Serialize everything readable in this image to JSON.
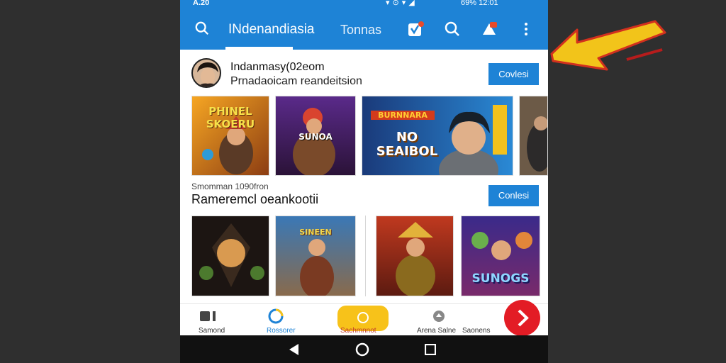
{
  "status_bar": {
    "left": "A.20",
    "right": "69% 12:01"
  },
  "app_bar": {
    "tabs": [
      {
        "label": "INdenandiasia"
      },
      {
        "label": "Tonnas"
      }
    ]
  },
  "section1": {
    "title": "Indanmasy(02eom",
    "subtitle": "Prnadaoicam reandeitsion",
    "button": "Covlesi",
    "cards": [
      {
        "label": "PHINEL SKOERU"
      },
      {
        "label": "SUNOA"
      },
      {
        "label_top": "BURNNARA",
        "label": "NO SEAIBOL"
      },
      {
        "label": ""
      }
    ]
  },
  "section2": {
    "caption": "Smomman 1090fron",
    "title": "Rameremcl oeankootii",
    "button": "Conlesi",
    "cards": [
      {
        "label": ""
      },
      {
        "label": "SINEEN"
      },
      {
        "label": ""
      },
      {
        "label": "SUNOGS"
      }
    ]
  },
  "bottom_nav": {
    "items": [
      {
        "label": "Samond"
      },
      {
        "label": "Rossorer"
      },
      {
        "label": "Sachmnnot"
      },
      {
        "label": "Arena Salne"
      },
      {
        "label": "Saonens"
      }
    ]
  },
  "colors": {
    "primary": "#1e83d6",
    "fab": "#e31c25",
    "highlight": "#f7c21a",
    "annotation_arrow": "#f2c41a"
  },
  "icons": {
    "app_bar": [
      "search-icon",
      "verified-badge-icon",
      "search-icon",
      "notification-icon",
      "more-vert-icon"
    ],
    "nav_bar": [
      "back-icon",
      "home-icon",
      "recents-icon"
    ]
  }
}
